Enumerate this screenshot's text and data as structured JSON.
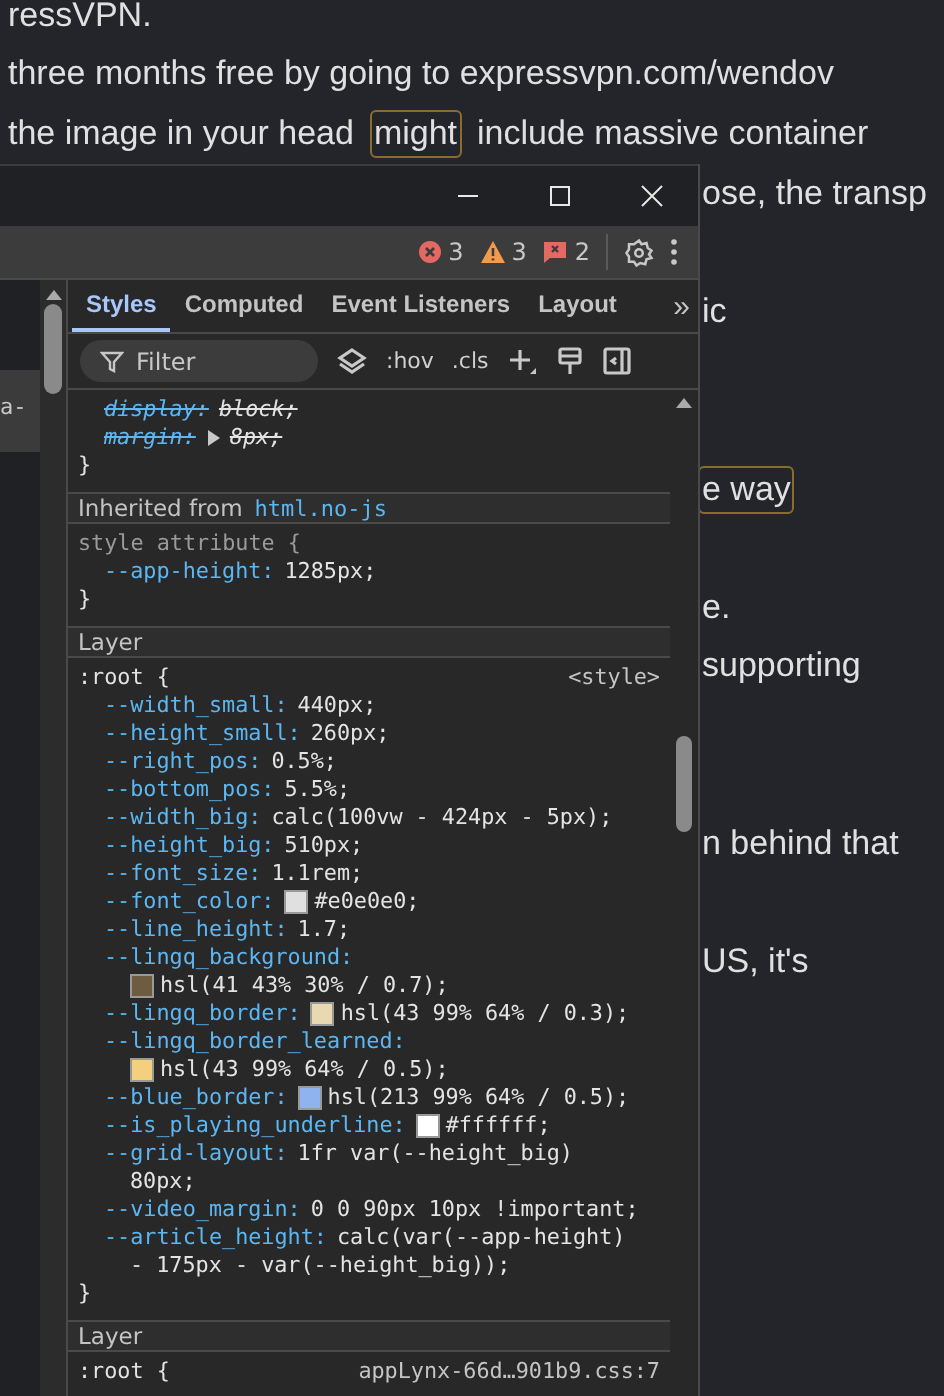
{
  "article": {
    "lines": [
      {
        "kind": "full",
        "segments": [
          {
            "text": "ressVPN.",
            "highlighted": false
          }
        ]
      },
      {
        "kind": "full",
        "segments": [
          {
            "text": "three months free by going to expressvpn.com/wendov",
            "highlighted": false
          }
        ]
      },
      {
        "kind": "full",
        "segments": [
          {
            "text": "the image in your head",
            "highlighted": false
          },
          {
            "text": "might",
            "highlighted": true
          },
          {
            "text": "include massive container",
            "highlighted": false
          }
        ]
      },
      {
        "kind": "beside",
        "segments": [
          {
            "text": "ose, the transp",
            "highlighted": false
          }
        ]
      },
      {
        "kind": "covered"
      },
      {
        "kind": "beside",
        "segments": [
          {
            "text": "ic",
            "highlighted": false
          }
        ]
      },
      {
        "kind": "covered"
      },
      {
        "kind": "covered"
      },
      {
        "kind": "beside",
        "segments": [
          {
            "text": "e way",
            "highlighted": true
          }
        ]
      },
      {
        "kind": "covered"
      },
      {
        "kind": "beside",
        "segments": [
          {
            "text": "e.",
            "highlighted": false
          }
        ]
      },
      {
        "kind": "beside",
        "segments": [
          {
            "text": "supporting",
            "highlighted": false
          }
        ]
      },
      {
        "kind": "covered"
      },
      {
        "kind": "covered"
      },
      {
        "kind": "beside",
        "segments": [
          {
            "text": "n behind that",
            "highlighted": false
          }
        ]
      },
      {
        "kind": "covered"
      },
      {
        "kind": "beside",
        "segments": [
          {
            "text": "US, it's",
            "highlighted": false
          }
        ]
      }
    ]
  },
  "devtools": {
    "toolbar": {
      "errors": "3",
      "warnings": "3",
      "issues": "2"
    },
    "elements_panel": {
      "snippet": "a-"
    },
    "tabs": [
      {
        "label": "Styles",
        "selected": true
      },
      {
        "label": "Computed",
        "selected": false
      },
      {
        "label": "Event Listeners",
        "selected": false
      },
      {
        "label": "Layout",
        "selected": false
      }
    ],
    "more_tabs": "»",
    "filter": {
      "placeholder": "Filter"
    },
    "filter_actions": [
      {
        "kind": "layers"
      },
      {
        "kind": "text",
        "label": ":hov"
      },
      {
        "kind": "text",
        "label": ".cls"
      },
      {
        "kind": "add"
      },
      {
        "kind": "brush"
      },
      {
        "kind": "sidebar"
      }
    ],
    "sections": [
      {
        "kind": "rule",
        "properties": [
          {
            "name": "display:",
            "value": [
              "block;"
            ],
            "overridden": true
          },
          {
            "name": "margin:",
            "value": [
              "8px;"
            ],
            "overridden": true,
            "expandable": true
          }
        ],
        "close": "}"
      },
      {
        "kind": "header",
        "label": "Inherited from",
        "element": "html.no-js"
      },
      {
        "kind": "rule",
        "selector": "style attribute {",
        "selector_dim": true,
        "properties": [
          {
            "name": "--app-height:",
            "value": [
              "1285px;"
            ],
            "overridden": false
          }
        ],
        "close": "}"
      },
      {
        "kind": "header",
        "label": "Layer"
      },
      {
        "kind": "rule",
        "selector": ":root {",
        "selector_dim": false,
        "source": "<style>",
        "properties": [
          {
            "name": "--width_small:",
            "value": [
              "440px;"
            ],
            "overridden": false
          },
          {
            "name": "--height_small:",
            "value": [
              "260px;"
            ],
            "overridden": false
          },
          {
            "name": "--right_pos:",
            "value": [
              "0.5%;"
            ],
            "overridden": false
          },
          {
            "name": "--bottom_pos:",
            "value": [
              "5.5%;"
            ],
            "overridden": false
          },
          {
            "name": "--width_big:",
            "value": [
              "calc(100vw - 424px - 5px);"
            ],
            "overridden": false
          },
          {
            "name": "--height_big:",
            "value": [
              "510px;"
            ],
            "overridden": false
          },
          {
            "name": "--font_size:",
            "value": [
              "1.1rem;"
            ],
            "overridden": false
          },
          {
            "name": "--font_color:",
            "value": [
              "#e0e0e0;"
            ],
            "color": "#e0e0e0",
            "overridden": false
          },
          {
            "name": "--line_height:",
            "value": [
              "1.7;"
            ],
            "overridden": false
          },
          {
            "name": "--lingq_background:",
            "value": [
              "hsl(41 43% 30% / 0.7);"
            ],
            "color": "#6e5c3f",
            "value_on_next_line": true,
            "overridden": false
          },
          {
            "name": "--lingq_border:",
            "value": [
              "hsl(43 99% 64% / 0.3);"
            ],
            "color": "#e9d9b0",
            "overridden": false
          },
          {
            "name": "--lingq_border_learned:",
            "value": [
              "hsl(43 99% 64% / 0.5);"
            ],
            "color": "#f3cf7e",
            "value_on_next_line": true,
            "overridden": false
          },
          {
            "name": "--blue_border:",
            "value": [
              "hsl(213 99% 64% / 0.5);"
            ],
            "color": "#8fb3ef",
            "overridden": false
          },
          {
            "name": "--is_playing_underline:",
            "value": [
              "#ffffff;"
            ],
            "color": "#ffffff",
            "overridden": false
          },
          {
            "name": "--grid-layout:",
            "value": [
              "1fr var(--height_big)",
              "80px;"
            ],
            "overridden": false
          },
          {
            "name": "--video_margin:",
            "value": [
              "0 0 90px 10px !important;"
            ],
            "overridden": false
          },
          {
            "name": "--article_height:",
            "value": [
              "calc(var(--app-height)",
              "- 175px - var(--height_big));"
            ],
            "overridden": false
          }
        ],
        "close": "}"
      },
      {
        "kind": "header",
        "label": "Layer"
      },
      {
        "kind": "rule",
        "selector": ":root {",
        "selector_dim": false,
        "source": "appLynx-66d…901b9.css:7"
      }
    ]
  }
}
